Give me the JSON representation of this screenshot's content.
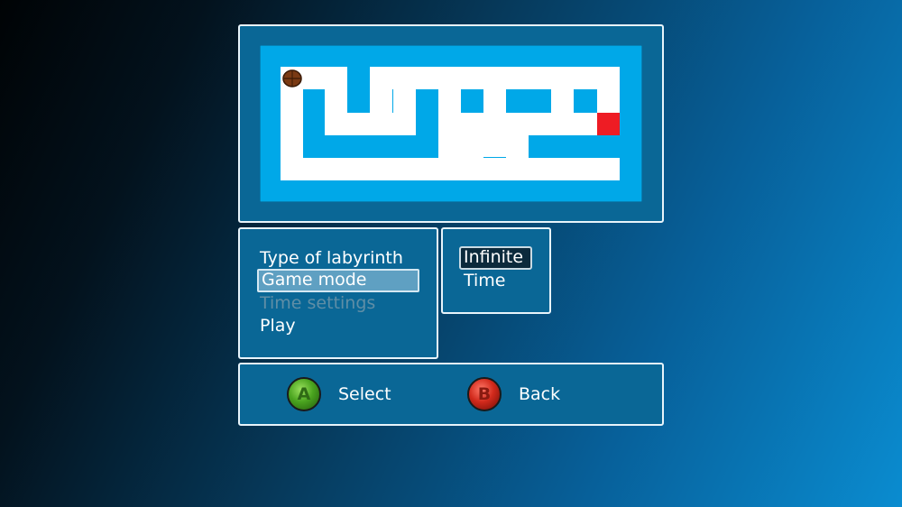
{
  "menu": {
    "items": [
      {
        "label": "Type of labyrinth",
        "state": "normal"
      },
      {
        "label": "Game mode",
        "state": "highlighted"
      },
      {
        "label": "Time settings",
        "state": "disabled"
      },
      {
        "label": "Play",
        "state": "normal"
      }
    ]
  },
  "options": {
    "items": [
      {
        "label": "Infinite",
        "selected": true
      },
      {
        "label": "Time",
        "selected": false
      }
    ]
  },
  "controls": {
    "select": {
      "button": "A",
      "label": "Select",
      "icon": "a-button-icon",
      "color": "#4aa41f"
    },
    "back": {
      "button": "B",
      "label": "Back",
      "icon": "b-button-icon",
      "color": "#d22a1c"
    }
  },
  "maze": {
    "player_icon": "player-ball-icon",
    "goal_icon": "goal-square-icon",
    "colors": {
      "border": "#00a8e8",
      "path": "#ffffff",
      "goal": "#ee1c24",
      "player": "#7a3a14"
    }
  }
}
